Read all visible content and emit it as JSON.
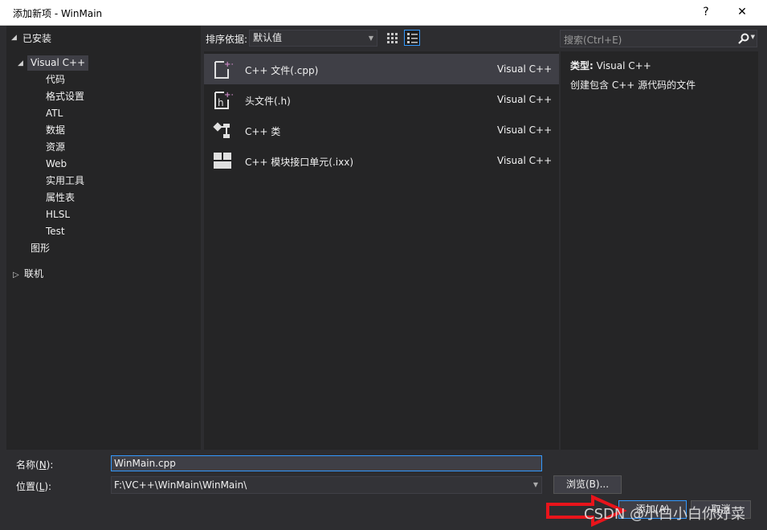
{
  "window": {
    "title": "添加新项 - WinMain",
    "help": "?",
    "close": "✕"
  },
  "sidebar": {
    "header": "已安装",
    "root": "Visual C++",
    "children": [
      "代码",
      "格式设置",
      "ATL",
      "数据",
      "资源",
      "Web",
      "实用工具",
      "属性表",
      "HLSL",
      "Test"
    ],
    "sibling": "图形",
    "online": "联机"
  },
  "toolbar": {
    "sort_label": "排序依据:",
    "sort_value": "默认值"
  },
  "search": {
    "placeholder": "搜索(Ctrl+E)"
  },
  "templates": [
    {
      "name": "C++ 文件(.cpp)",
      "lang": "Visual C++",
      "icon": "cpp-file-icon"
    },
    {
      "name": "头文件(.h)",
      "lang": "Visual C++",
      "icon": "header-file-icon"
    },
    {
      "name": "C++ 类",
      "lang": "Visual C++",
      "icon": "class-icon"
    },
    {
      "name": "C++ 模块接口单元(.ixx)",
      "lang": "Visual C++",
      "icon": "module-icon"
    }
  ],
  "details": {
    "type_label": "类型:",
    "type_value": "Visual C++",
    "description": "创建包含 C++ 源代码的文件"
  },
  "form": {
    "name_label": "名称(",
    "name_key": "N",
    "name_label_end": "):",
    "name_value": "WinMain.cpp",
    "location_label": "位置(",
    "location_key": "L",
    "location_label_end": "):",
    "location_value": "F:\\VC++\\WinMain\\WinMain\\",
    "browse_label": "浏览(B)...",
    "add_label": "添加(A)",
    "cancel_label": "取消"
  },
  "watermark": "CSDN @小白小白你好菜",
  "colors": {
    "accent": "#3399ff",
    "annotation": "#e8141b",
    "background": "#2d2d30",
    "panel": "#252526"
  }
}
